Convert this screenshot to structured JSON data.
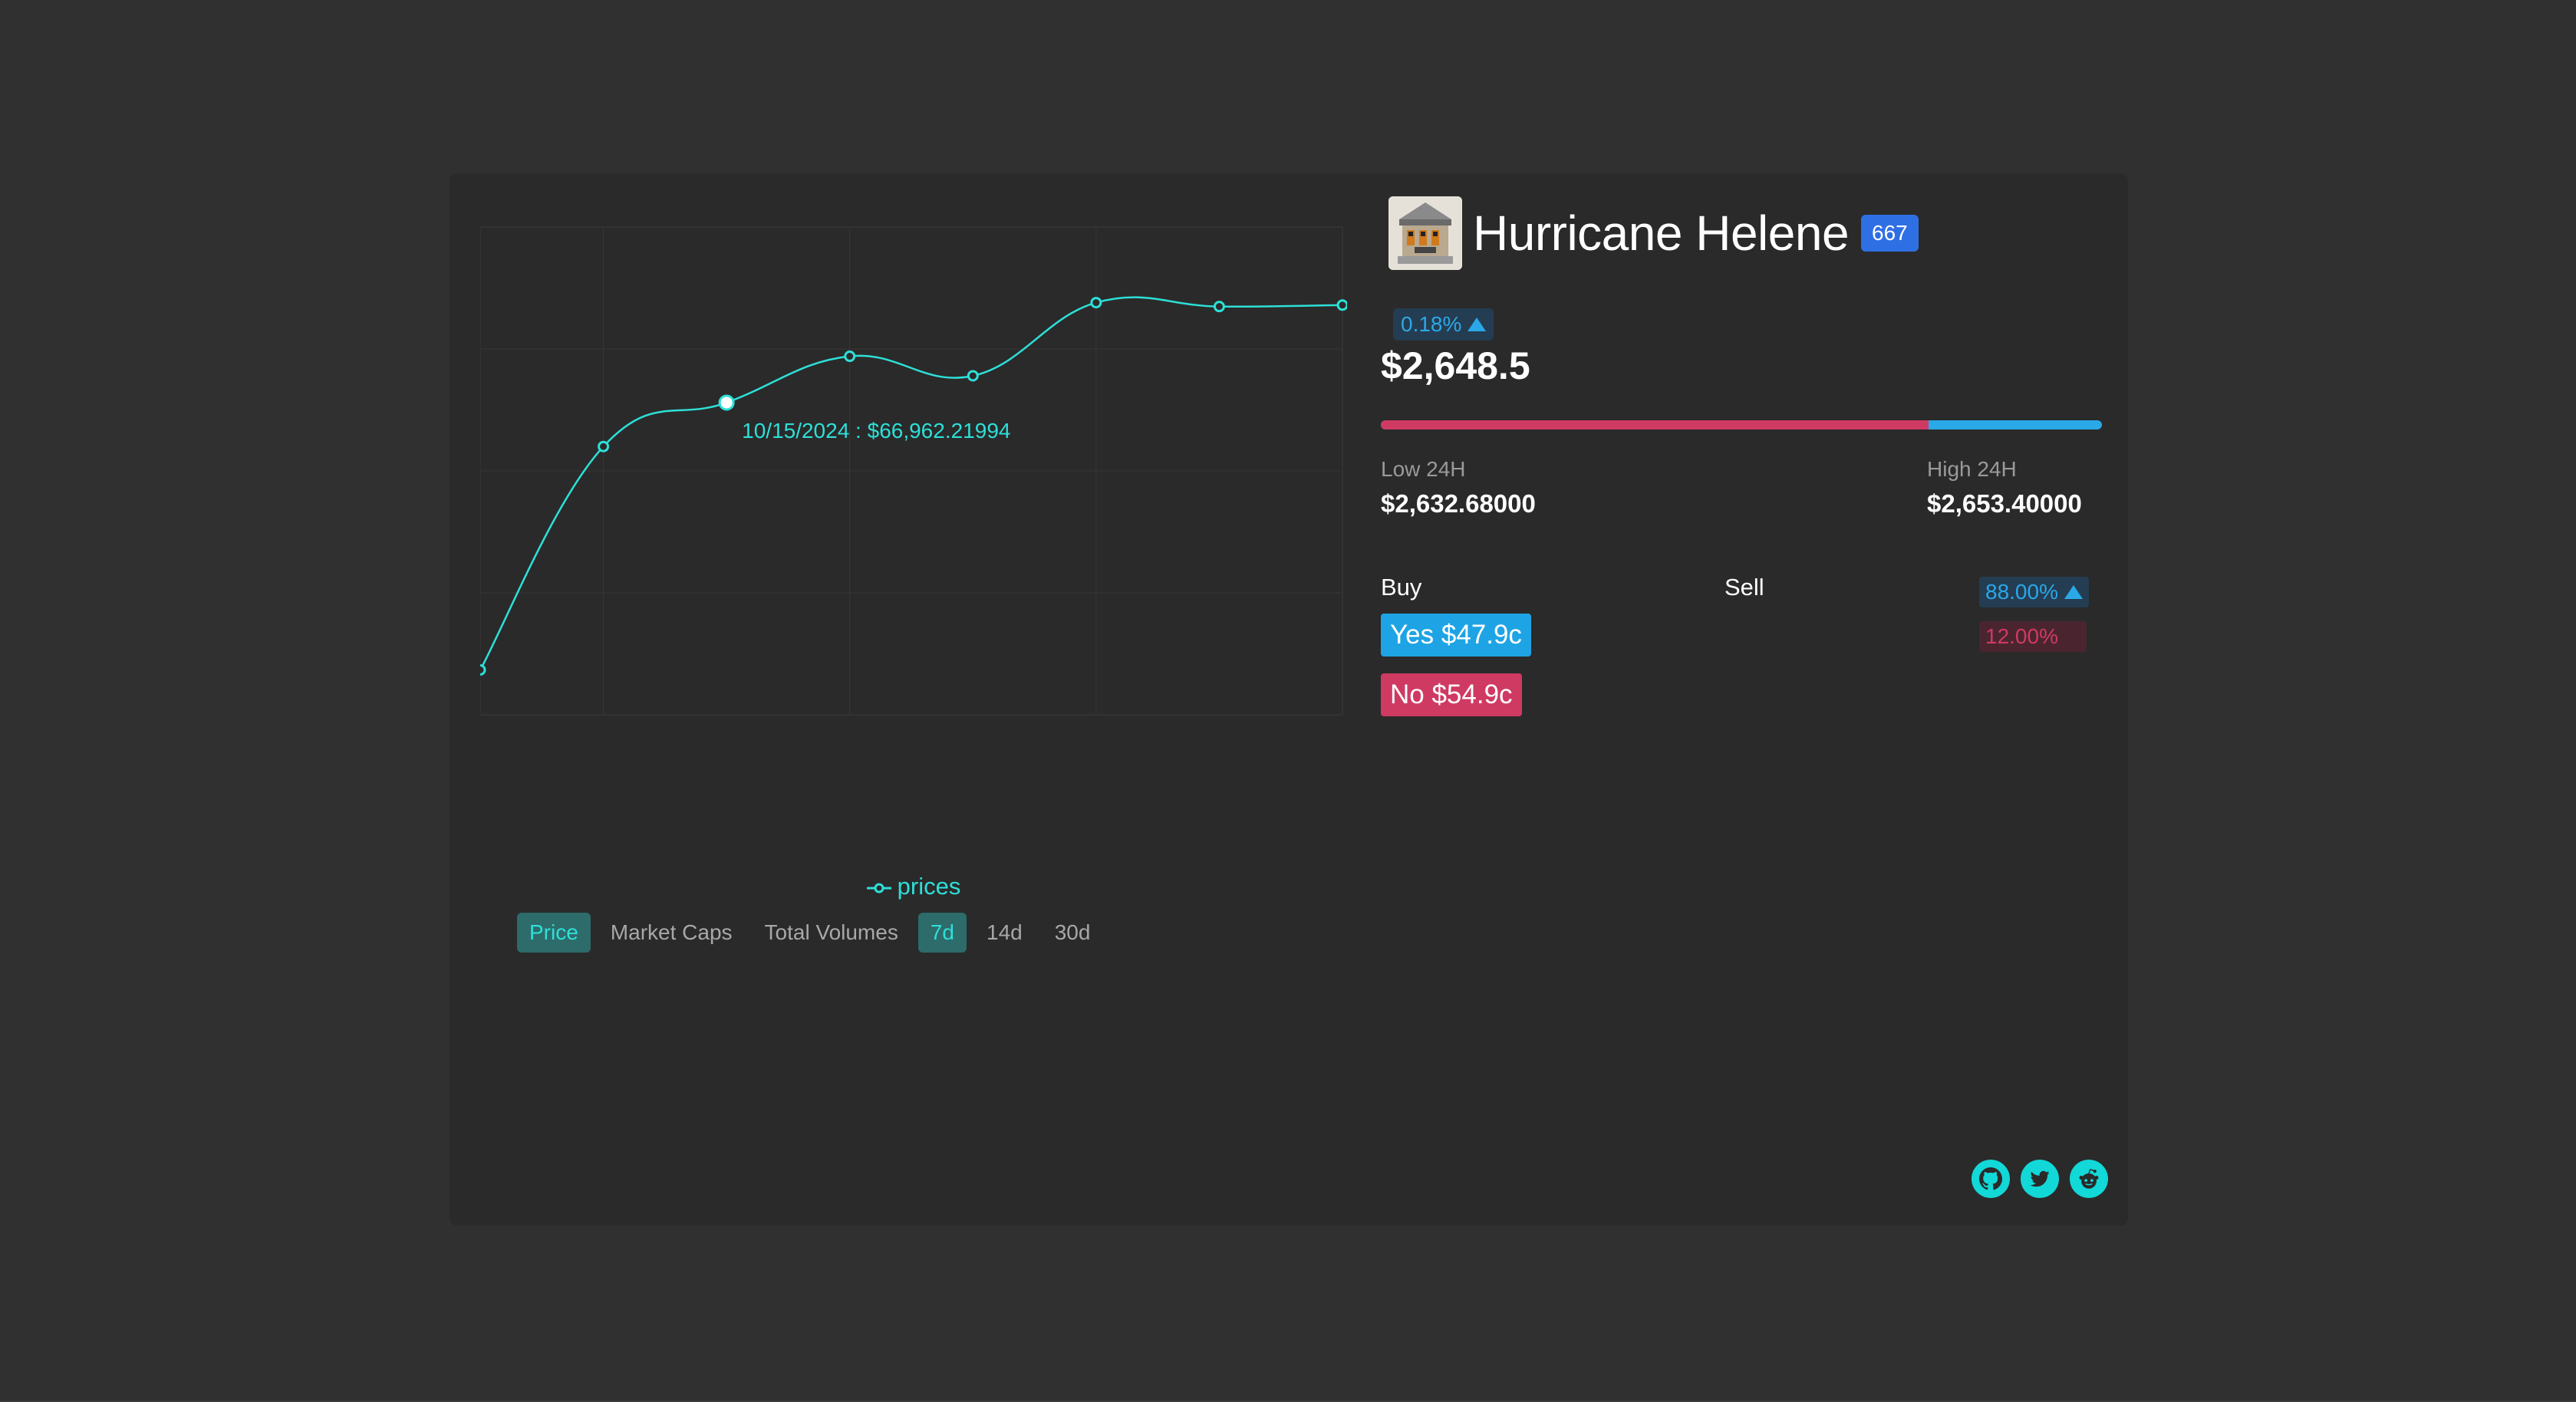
{
  "market": {
    "title": "Hurricane Helene",
    "rank": "667",
    "change_pct": "0.18%",
    "price": "$2,648.5",
    "low_label": "Low 24H",
    "low_value": "$2,632.68000",
    "high_label": "High 24H",
    "high_value": "$2,653.40000",
    "range_fraction": 0.76
  },
  "trade": {
    "buy_label": "Buy",
    "sell_label": "Sell",
    "yes_label": "Yes $47.9c",
    "no_label": "No $54.9c",
    "yes_pct": "88.00%",
    "no_pct": "12.00%"
  },
  "tabs": {
    "metrics": [
      "Price",
      "Market Caps",
      "Total Volumes"
    ],
    "ranges": [
      "7d",
      "14d",
      "30d"
    ],
    "active_metric": "Price",
    "active_range": "7d"
  },
  "tooltip": {
    "text": "10/15/2024 : $66,962.21994"
  },
  "socials": [
    "github-icon",
    "twitter-icon",
    "reddit-icon"
  ],
  "colors": {
    "accent": "#2de0d8",
    "yes": "#1ea4e4",
    "no": "#cf3a62",
    "rank_badge": "#2f6fe4"
  },
  "chart_data": {
    "type": "line",
    "series": [
      {
        "name": "prices",
        "values": [
          0.092,
          0.55,
          0.64,
          0.735,
          0.695,
          0.845,
          0.837,
          0.84
        ]
      }
    ],
    "x": [
      0,
      1,
      2,
      3,
      4,
      5,
      6,
      7
    ],
    "highlight_index": 2,
    "ylim": [
      0,
      1
    ],
    "grid": true,
    "legend": "bottom",
    "xlabel": "",
    "ylabel": ""
  }
}
